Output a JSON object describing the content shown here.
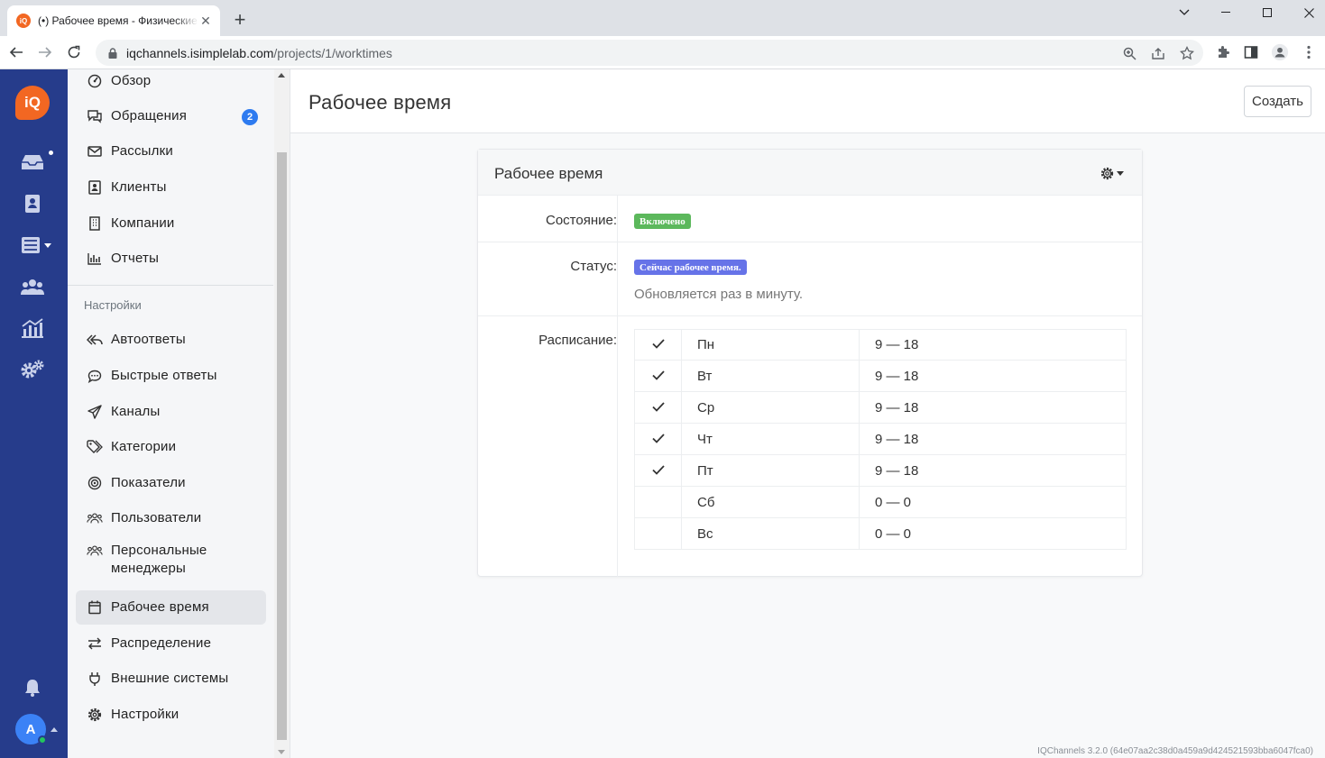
{
  "browser": {
    "tab_title": "(•) Рабочее время - Физические лица",
    "favicon_text": "iQ",
    "url_host": "iqchannels.isimplelab.com",
    "url_path": "/projects/1/worktimes"
  },
  "rail": {
    "logo_text": "iQ",
    "avatar_initial": "A",
    "icons": [
      "inbox-icon",
      "contacts-icon",
      "list-menu-icon",
      "team-icon",
      "analytics-icon",
      "settings-gears-icon",
      "bell-icon"
    ]
  },
  "sidebar": {
    "items": [
      {
        "label": "Обзор",
        "icon": "dashboard-icon"
      },
      {
        "label": "Обращения",
        "icon": "chat-icon",
        "badge": "2"
      },
      {
        "label": "Рассылки",
        "icon": "mail-icon"
      },
      {
        "label": "Клиенты",
        "icon": "client-card-icon"
      },
      {
        "label": "Компании",
        "icon": "building-icon"
      },
      {
        "label": "Отчеты",
        "icon": "bar-chart-icon"
      }
    ],
    "settings_section": "Настройки",
    "settings_items": [
      {
        "label": "Автоответы",
        "icon": "auto-reply-icon"
      },
      {
        "label": "Быстрые ответы",
        "icon": "quick-reply-icon"
      },
      {
        "label": "Каналы",
        "icon": "send-icon"
      },
      {
        "label": "Категории",
        "icon": "tag-icon"
      },
      {
        "label": "Показатели",
        "icon": "target-icon"
      },
      {
        "label": "Пользователи",
        "icon": "users-icon"
      },
      {
        "label": "Персональные менеджеры",
        "icon": "managers-icon"
      },
      {
        "label": "Рабочее время",
        "icon": "calendar-icon",
        "active": true
      },
      {
        "label": "Распределение",
        "icon": "swap-icon"
      },
      {
        "label": "Внешние системы",
        "icon": "plug-icon"
      },
      {
        "label": "Настройки",
        "icon": "gear-icon"
      }
    ]
  },
  "page": {
    "title": "Рабочее время",
    "create_button": "Создать"
  },
  "card": {
    "title": "Рабочее время",
    "state_label": "Состояние:",
    "state_value": "Включено",
    "status_label": "Статус:",
    "status_value": "Сейчас рабочее время.",
    "status_note": "Обновляется раз в минуту.",
    "schedule_label": "Расписание:",
    "schedule": [
      {
        "enabled": true,
        "day": "Пн",
        "hours": "9 — 18"
      },
      {
        "enabled": true,
        "day": "Вт",
        "hours": "9 — 18"
      },
      {
        "enabled": true,
        "day": "Ср",
        "hours": "9 — 18"
      },
      {
        "enabled": true,
        "day": "Чт",
        "hours": "9 — 18"
      },
      {
        "enabled": true,
        "day": "Пт",
        "hours": "9 — 18"
      },
      {
        "enabled": false,
        "day": "Сб",
        "hours": "0 — 0"
      },
      {
        "enabled": false,
        "day": "Вс",
        "hours": "0 — 0"
      }
    ]
  },
  "footer": {
    "version": "IQChannels 3.2.0 (64e07aa2c38d0a459a9d424521593bba6047fca0)"
  },
  "colors": {
    "rail_bg": "#263c8b",
    "brand_orange": "#f26722",
    "badge_blue": "#2e7bf0",
    "enabled_green": "#5cb85c",
    "status_blue": "#6673e8"
  }
}
